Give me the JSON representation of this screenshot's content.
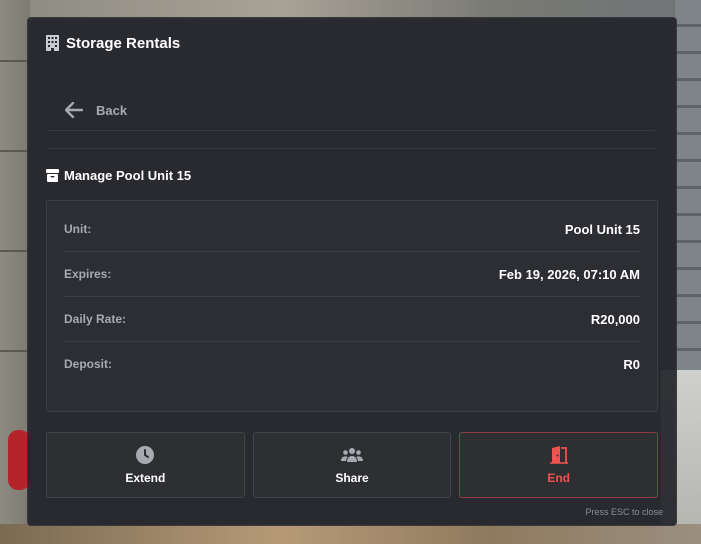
{
  "panel": {
    "title": "Storage Rentals",
    "title_icon": "building-icon"
  },
  "back": {
    "label": "Back",
    "icon": "arrow-left-icon"
  },
  "section": {
    "title": "Manage Pool Unit 15",
    "icon": "box-icon"
  },
  "details": [
    {
      "label": "Unit:",
      "value": "Pool Unit 15"
    },
    {
      "label": "Expires:",
      "value": "Feb 19, 2026, 07:10 AM"
    },
    {
      "label": "Daily Rate:",
      "value": "R20,000"
    },
    {
      "label": "Deposit:",
      "value": "R0"
    }
  ],
  "actions": {
    "extend": {
      "label": "Extend",
      "icon": "clock-icon"
    },
    "share": {
      "label": "Share",
      "icon": "users-icon"
    },
    "end": {
      "label": "End",
      "icon": "door-open-icon",
      "color": "#ef5350"
    }
  },
  "footer": {
    "hint": "Press ESC to close"
  }
}
